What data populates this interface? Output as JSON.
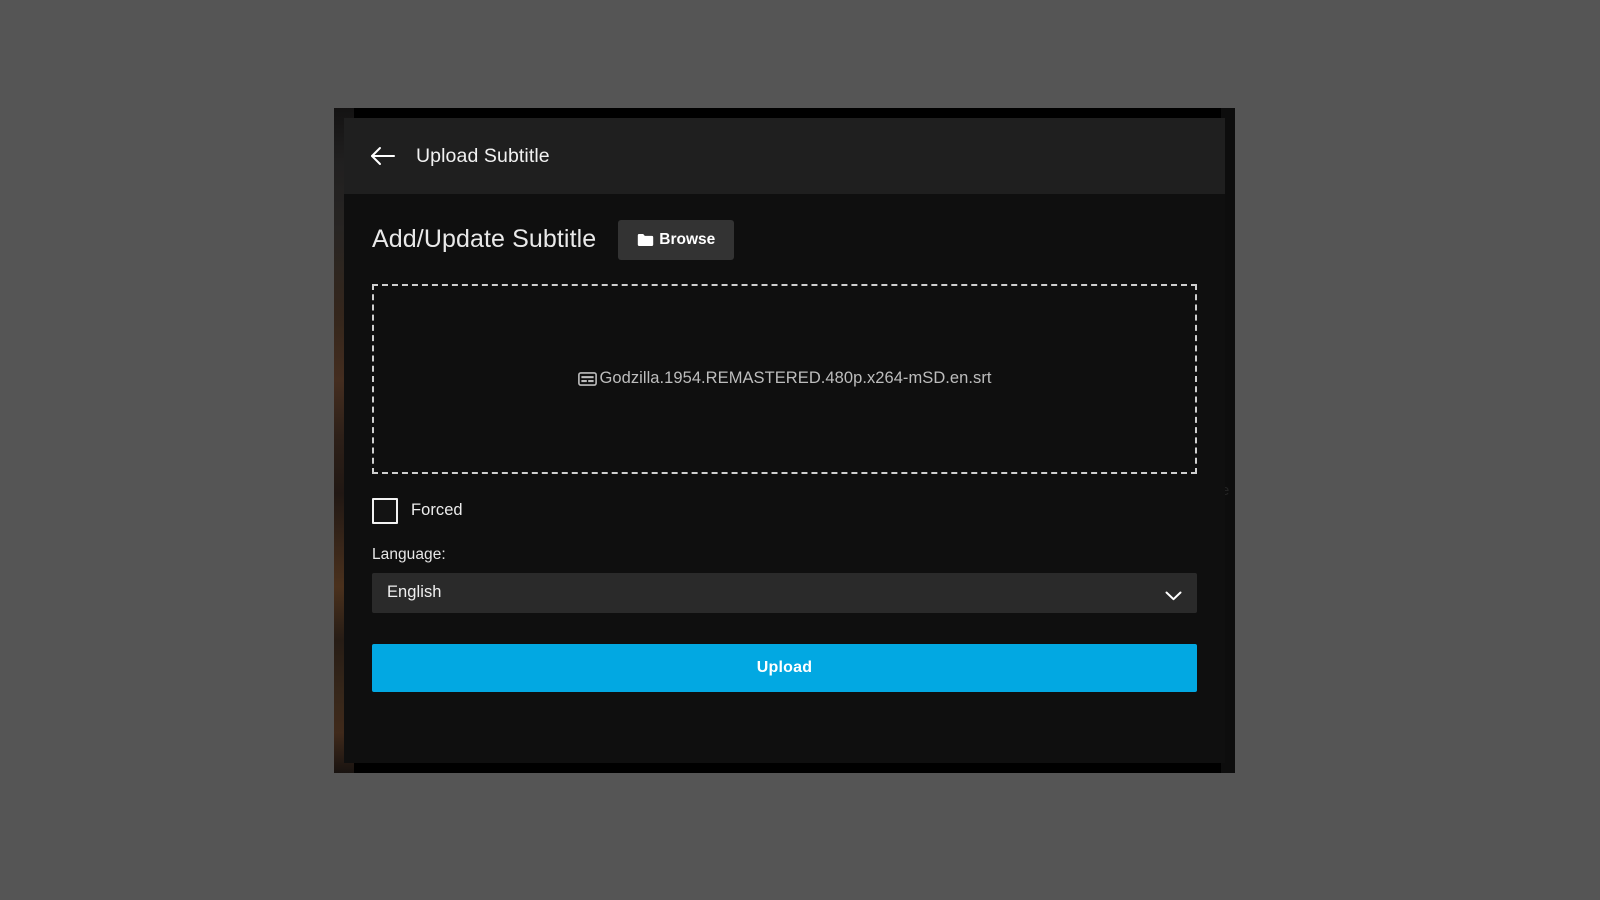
{
  "page": {
    "backdrop_color": "#555555"
  },
  "dialog": {
    "header": {
      "back_icon": "arrow-left-icon",
      "title": "Upload Subtitle"
    },
    "section": {
      "heading": "Add/Update Subtitle",
      "browse_button": {
        "label": "Browse",
        "icon": "folder-icon"
      }
    },
    "dropzone": {
      "file_icon": "closed-caption-icon",
      "file_name": "Godzilla.1954.REMASTERED.480p.x264-mSD.en.srt"
    },
    "forced": {
      "label": "Forced",
      "checked": false
    },
    "language": {
      "label": "Language:",
      "selected": "English",
      "chevron_icon": "chevron-down-icon"
    },
    "upload_button": {
      "label": "Upload",
      "color": "#02A8E2"
    }
  },
  "background": {
    "edge_glyphs": "e\ne"
  }
}
